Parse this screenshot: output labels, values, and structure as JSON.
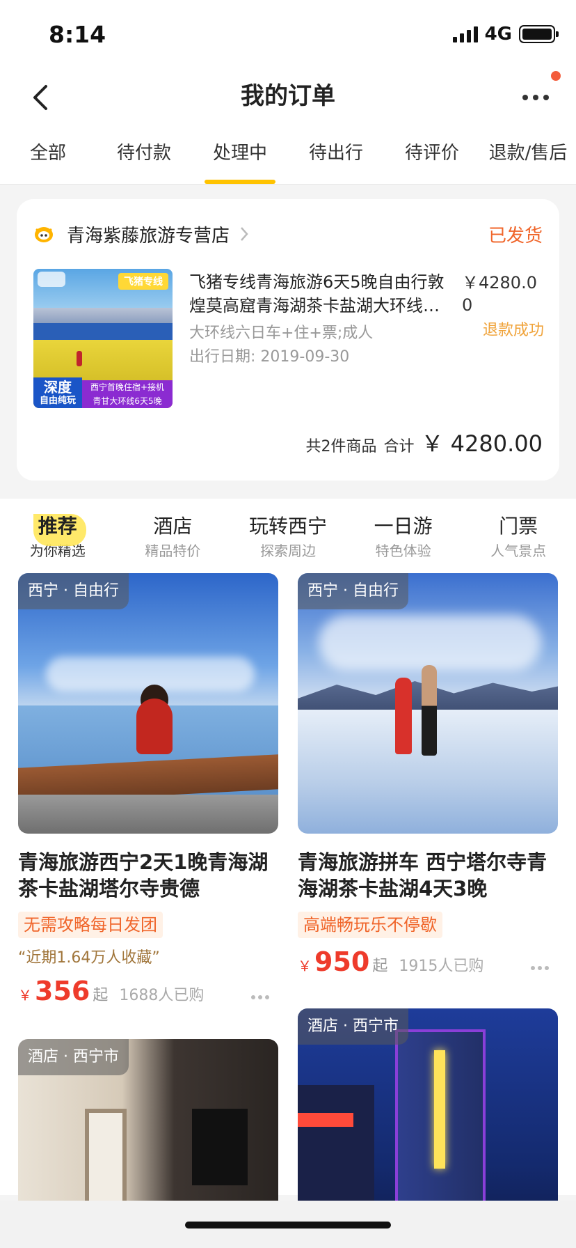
{
  "status": {
    "time": "8:14",
    "network": "4G"
  },
  "header": {
    "title": "我的订单"
  },
  "order_tabs": [
    "全部",
    "待付款",
    "处理中",
    "待出行",
    "待评价",
    "退款/售后"
  ],
  "order": {
    "store_name": "青海紫藤旅游专营店",
    "status": "已发货",
    "product_title": "飞猪专线青海旅游6天5晚自由行敦煌莫高窟青海湖茶卡盐湖大环线六日车+住+票;成人",
    "spec": "大环线六日车+住+票;成人",
    "date": "出行日期: 2019-09-30",
    "price": "￥4280.00",
    "refund_status": "退款成功",
    "image_badge": "飞猪专线",
    "image_overlay_left": "深度",
    "image_overlay_left_sub": "自由纯玩",
    "image_overlay_right_1": "西宁首晚住宿+接机",
    "image_overlay_right_2": "青甘大环线6天5晚",
    "summary_count": "共2件商品",
    "summary_label": "合计",
    "summary_total": "￥ 4280.00"
  },
  "rec_tabs": [
    {
      "title": "推荐",
      "sub": "为你精选"
    },
    {
      "title": "酒店",
      "sub": "精品特价"
    },
    {
      "title": "玩转西宁",
      "sub": "探索周边"
    },
    {
      "title": "一日游",
      "sub": "特色体验"
    },
    {
      "title": "门票",
      "sub": "人气景点"
    }
  ],
  "cards": [
    {
      "tag": "西宁 · 自由行",
      "title": "青海旅游西宁2天1晚青海湖茶卡盐湖塔尔寺贵德",
      "badge": "无需攻略每日发团",
      "quote": "“近期1.64万人收藏”",
      "currency": "￥",
      "price": "356",
      "suffix": "起",
      "sold": "1688人已购"
    },
    {
      "tag": "西宁 · 自由行",
      "title": "青海旅游拼车 西宁塔尔寺青海湖茶卡盐湖4天3晚",
      "badge": "高端畅玩乐不停歇",
      "currency": "￥",
      "price": "950",
      "suffix": "起",
      "sold": "1915人已购"
    },
    {
      "tag": "酒店 · 西宁市"
    },
    {
      "tag": "酒店 · 西宁市"
    }
  ],
  "colors": {
    "accent": "#ffc300",
    "orange": "#f0652a",
    "price_red": "#ee3b2b"
  }
}
